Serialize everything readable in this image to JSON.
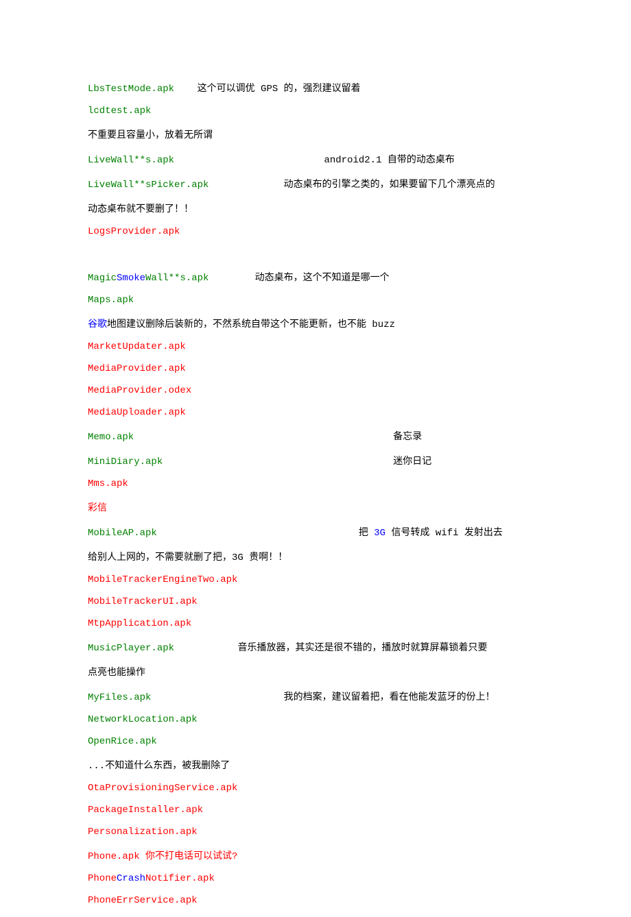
{
  "lines": [
    {
      "segments": [
        {
          "cls": "green",
          "text": "LbsTestMode.apk"
        },
        {
          "cls": "black",
          "text": "    这个可以调优 GPS 的，强烈建议留着"
        }
      ]
    },
    {
      "segments": [
        {
          "cls": "green",
          "text": "lcdtest.apk"
        }
      ]
    },
    {
      "segments": [
        {
          "cls": "black",
          "text": "不重要且容量小，放着无所谓"
        }
      ]
    },
    {
      "segments": [
        {
          "cls": "green",
          "text": "LiveWall**s.apk"
        },
        {
          "cls": "black",
          "text": "                          android2.1 自带的动态桌布"
        }
      ]
    },
    {
      "segments": [
        {
          "cls": "green",
          "text": "LiveWall**sPicker.apk"
        },
        {
          "cls": "black",
          "text": "             动态桌布的引擎之类的，如果要留下几个漂亮点的"
        }
      ]
    },
    {
      "segments": [
        {
          "cls": "black",
          "text": "动态桌布就不要删了！！"
        }
      ]
    },
    {
      "segments": [
        {
          "cls": "red",
          "text": "LogsProvider.apk"
        }
      ]
    },
    {
      "segments": [
        {
          "cls": "black",
          "text": " "
        }
      ]
    },
    {
      "segments": [
        {
          "cls": "green",
          "text": "Magic"
        },
        {
          "cls": "blue",
          "text": "Smoke"
        },
        {
          "cls": "green",
          "text": "Wall**s.apk"
        },
        {
          "cls": "black",
          "text": "        动态桌布，这个不知道是哪一个"
        }
      ]
    },
    {
      "segments": [
        {
          "cls": "green",
          "text": "Maps.apk"
        }
      ]
    },
    {
      "segments": [
        {
          "cls": "blue",
          "text": "谷歌"
        },
        {
          "cls": "black",
          "text": "地图建议删除后装新的，不然系统自带这个不能更新，也不能 buzz"
        }
      ]
    },
    {
      "segments": [
        {
          "cls": "red",
          "text": "MarketUpdater.apk"
        }
      ]
    },
    {
      "segments": [
        {
          "cls": "red",
          "text": "MediaProvider.apk"
        }
      ]
    },
    {
      "segments": [
        {
          "cls": "red",
          "text": "MediaProvider.odex"
        }
      ]
    },
    {
      "segments": [
        {
          "cls": "red",
          "text": "MediaUploader.apk"
        }
      ]
    },
    {
      "segments": [
        {
          "cls": "green",
          "text": "Memo.apk"
        },
        {
          "cls": "black",
          "text": "                                             备忘录"
        }
      ]
    },
    {
      "segments": [
        {
          "cls": "green",
          "text": "MiniDiary.apk"
        },
        {
          "cls": "black",
          "text": "                                        迷你日记"
        }
      ]
    },
    {
      "segments": [
        {
          "cls": "red",
          "text": "Mms.apk"
        }
      ]
    },
    {
      "segments": [
        {
          "cls": "red",
          "text": "彩信"
        }
      ]
    },
    {
      "segments": [
        {
          "cls": "green",
          "text": "MobileAP.apk"
        },
        {
          "cls": "black",
          "text": "                                   把 "
        },
        {
          "cls": "blue",
          "text": "3G"
        },
        {
          "cls": "black",
          "text": " 信号转成 wifi 发射出去"
        }
      ]
    },
    {
      "segments": [
        {
          "cls": "black",
          "text": "给别人上网的，不需要就删了把，3G 贵啊！！"
        }
      ]
    },
    {
      "segments": [
        {
          "cls": "red",
          "text": "MobileTrackerEngineTwo.apk"
        }
      ]
    },
    {
      "segments": [
        {
          "cls": "red",
          "text": "MobileTrackerUI.apk"
        }
      ]
    },
    {
      "segments": [
        {
          "cls": "red",
          "text": "MtpApplication.apk"
        }
      ]
    },
    {
      "segments": [
        {
          "cls": "green",
          "text": "MusicPlayer.apk"
        },
        {
          "cls": "black",
          "text": "           音乐播放器，其实还是很不错的，播放时就算屏幕锁着只要"
        }
      ]
    },
    {
      "segments": [
        {
          "cls": "black",
          "text": "点亮也能操作"
        }
      ]
    },
    {
      "segments": [
        {
          "cls": "green",
          "text": "MyFiles.apk"
        },
        {
          "cls": "black",
          "text": "                       我的档案，建议留着把，看在他能发蓝牙的份上！"
        }
      ]
    },
    {
      "segments": [
        {
          "cls": "green",
          "text": "NetworkLocation.apk"
        }
      ]
    },
    {
      "segments": [
        {
          "cls": "green",
          "text": "OpenRice.apk"
        }
      ]
    },
    {
      "segments": [
        {
          "cls": "black",
          "text": "...不知道什么东西，被我删除了"
        }
      ]
    },
    {
      "segments": [
        {
          "cls": "red",
          "text": "OtaProvisioningService.apk"
        }
      ]
    },
    {
      "segments": [
        {
          "cls": "red",
          "text": "PackageInstaller.apk"
        }
      ]
    },
    {
      "segments": [
        {
          "cls": "red",
          "text": "Personalization.apk"
        }
      ]
    },
    {
      "segments": [
        {
          "cls": "red",
          "text": "Phone.apk 你不打电话可以试试?"
        }
      ]
    },
    {
      "segments": [
        {
          "cls": "red",
          "text": "Phone"
        },
        {
          "cls": "blue",
          "text": "Crash"
        },
        {
          "cls": "red",
          "text": "Notifier.apk"
        }
      ]
    },
    {
      "segments": [
        {
          "cls": "red",
          "text": "PhoneErrService.apk"
        }
      ]
    }
  ]
}
